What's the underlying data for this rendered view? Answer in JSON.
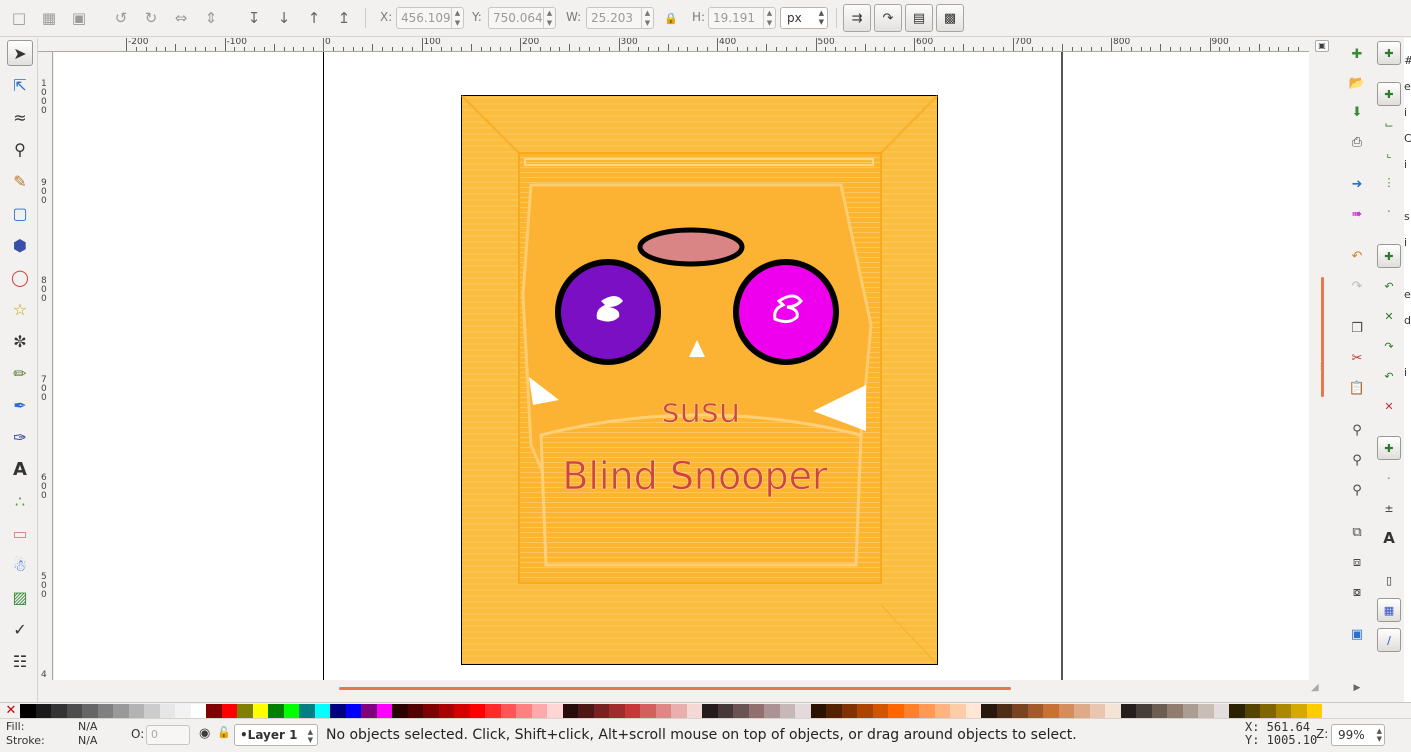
{
  "toolbar": {
    "x_label": "X:",
    "x_value": "456.109",
    "y_label": "Y:",
    "y_value": "750.064",
    "w_label": "W:",
    "w_value": "25.203",
    "h_label": "H:",
    "h_value": "19.191",
    "unit": "px"
  },
  "ruler": {
    "h_labels": [
      "-200",
      "-100",
      "0",
      "100",
      "200",
      "300",
      "400",
      "500",
      "600",
      "700",
      "800",
      "900"
    ],
    "v_labels": [
      "1000",
      "900",
      "800",
      "700",
      "600",
      "500",
      "4"
    ]
  },
  "artwork": {
    "background_color": "#fbbd3e",
    "small_text": "susu",
    "large_text": "Blind Snooper",
    "text_color": "#d0453d",
    "left_eye_color": "#7b0fc4",
    "right_eye_color": "#ee00ee",
    "nose_color": "#d98585"
  },
  "palette": {
    "colors": [
      "#000000",
      "#1a1a1a",
      "#333333",
      "#4d4d4d",
      "#666666",
      "#808080",
      "#999999",
      "#b3b3b3",
      "#cccccc",
      "#e6e6e6",
      "#f2f2f2",
      "#ffffff",
      "#800000",
      "#ff0000",
      "#808000",
      "#ffff00",
      "#008000",
      "#00ff00",
      "#008080",
      "#00ffff",
      "#000080",
      "#0000ff",
      "#800080",
      "#ff00ff",
      "#2b0000",
      "#550000",
      "#800000",
      "#aa0000",
      "#d40000",
      "#ff0000",
      "#ff2a2a",
      "#ff5555",
      "#ff8080",
      "#ffaaaa",
      "#ffd5d5",
      "#280b0b",
      "#501616",
      "#782121",
      "#a02c2c",
      "#c83737",
      "#d35f5f",
      "#de8787",
      "#e9afaf",
      "#f4d7d7",
      "#241c1c",
      "#483737",
      "#6c5353",
      "#916f6f",
      "#ac9393",
      "#c8b7b7",
      "#e3dbdb",
      "#2b1100",
      "#552200",
      "#803300",
      "#aa4400",
      "#d45500",
      "#ff6600",
      "#ff7f2a",
      "#ff9955",
      "#ffb380",
      "#ffccaa",
      "#ffe6d5",
      "#28170b",
      "#502d16",
      "#784421",
      "#a05a2c",
      "#c87137",
      "#d38d5f",
      "#deaa87",
      "#e9c6af",
      "#f4e3d7",
      "#241f1c",
      "#483e37",
      "#6c5d53",
      "#917c6f",
      "#ac9d93",
      "#c8beb7",
      "#e3dedb",
      "#2b2200",
      "#554400",
      "#806600",
      "#aa8800",
      "#d4aa00",
      "#ffcc00"
    ]
  },
  "status": {
    "fill_label": "Fill:",
    "fill_value": "N/A",
    "stroke_label": "Stroke:",
    "stroke_value": "N/A",
    "opacity_label": "O:",
    "opacity_value": "0",
    "layer": "•Layer 1",
    "message": "No objects selected. Click, Shift+click, Alt+scroll mouse on top of objects, or drag around objects to select.",
    "cursor_x": "X:  561.64",
    "cursor_y": "Y: 1005.10",
    "zoom_label": "Z:",
    "zoom_value": "99%"
  },
  "right_edge_text": "#\ne\ni\nC\ni\n\ns\ni\n\ne\nd\n\ni"
}
